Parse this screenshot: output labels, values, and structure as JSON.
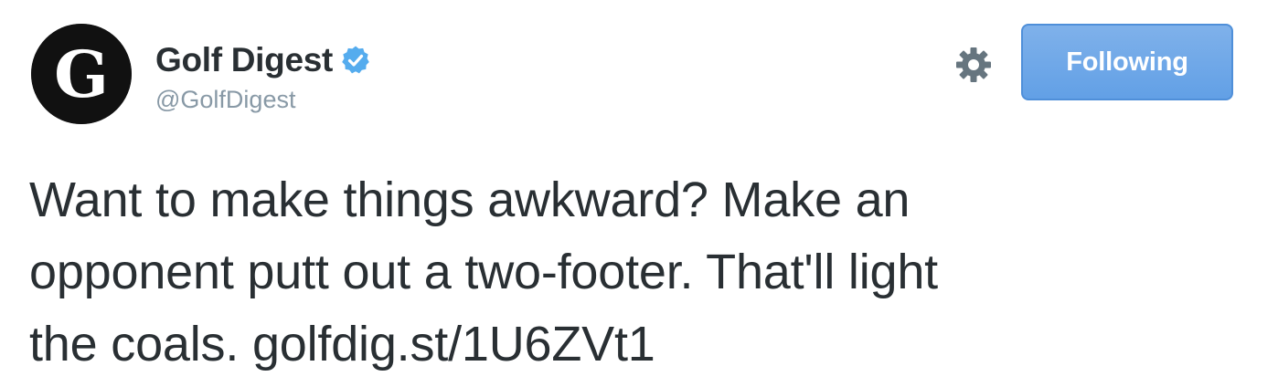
{
  "tweet": {
    "author": {
      "display_name": "Golf Digest",
      "handle": "@GolfDigest",
      "verified": true,
      "avatar_letter": "G"
    },
    "follow_button_label": "Following",
    "text_lines": [
      "Want to make things awkward? Make an",
      "opponent putt out a two-footer. That'll light",
      "the coals. "
    ],
    "link_text": "golfdig.st/1U6ZVt1"
  },
  "icons": {
    "verified": "verified-badge-icon",
    "settings": "gear-icon"
  },
  "colors": {
    "follow_button": "#62a0e6",
    "verified_badge": "#55acee",
    "handle_text": "#8899a6",
    "body_text": "#292f33",
    "avatar_background": "#111111"
  }
}
